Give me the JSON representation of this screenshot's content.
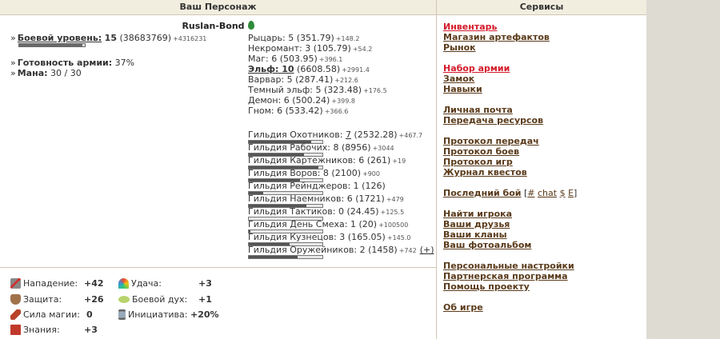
{
  "left_header": "Ваш Персонаж",
  "right_header": "Сервисы",
  "hero": {
    "name": "Ruslan-Bond",
    "combat_level_label": "Боевой уровень:",
    "combat_level_value": "15",
    "combat_level_exp": "(38683769)",
    "combat_level_delta": "+4316231",
    "combat_level_progress": 0.96,
    "army_ready_label": "Готовность армии:",
    "army_ready_value": "37%",
    "mana_label": "Мана:",
    "mana_value": "30 / 30"
  },
  "classes": [
    {
      "label": "Рыцарь: 5 (351.79)",
      "delta": "+148.2",
      "bold": false
    },
    {
      "label": "Некромант: 3 (105.79)",
      "delta": "+54.2",
      "bold": false
    },
    {
      "label": "Маг: 6 (503.95)",
      "delta": "+396.1",
      "bold": false
    },
    {
      "label_main": "Эльф: 10",
      "label_rest": " (6608.58)",
      "delta": "+2991.4",
      "bold": true
    },
    {
      "label": "Варвар: 5 (287.41)",
      "delta": "+212.6",
      "bold": false
    },
    {
      "label": "Темный эльф: 5 (323.48)",
      "delta": "+176.5",
      "bold": false
    },
    {
      "label": "Демон: 6 (500.24)",
      "delta": "+399.8",
      "bold": false
    },
    {
      "label": "Гном: 6 (533.42)",
      "delta": "+366.6",
      "bold": false
    }
  ],
  "guilds": [
    {
      "prefix": "Гильдия Охотников: ",
      "level": "7",
      "rest": " (2532.28)",
      "delta": "+467.7",
      "progress": 0.85,
      "level_link": true
    },
    {
      "prefix": "Гильдия Рабочих: 8",
      "level": "",
      "rest": " (8956)",
      "delta": "+3044",
      "progress": 0.75,
      "level_link": false
    },
    {
      "prefix": "Гильдия Картежников: 6",
      "level": "",
      "rest": " (261)",
      "delta": "+19",
      "progress": 0.95,
      "level_link": false
    },
    {
      "prefix": "Гильдия Воров: 8",
      "level": "",
      "rest": " (2100)",
      "delta": "+900",
      "progress": 0.7,
      "level_link": false
    },
    {
      "prefix": "Гильдия Рейнджеров: 1",
      "level": "",
      "rest": " (126)",
      "delta": "",
      "progress": 0.2,
      "level_link": false
    },
    {
      "prefix": "Гильдия Наемников: 6",
      "level": "",
      "rest": " (1721)",
      "delta": "+479",
      "progress": 0.78,
      "level_link": false
    },
    {
      "prefix": "Гильдия Тактиков: 0",
      "level": "",
      "rest": " (24.45)",
      "delta": "+125.5",
      "progress": 0.0,
      "level_link": false
    },
    {
      "prefix": "Гильдия День Смеха: 1",
      "level": "",
      "rest": " (20)",
      "delta": "+100500",
      "progress": 0.02,
      "level_link": false
    },
    {
      "prefix": "Гильдия Кузнецов: 3",
      "level": "",
      "rest": " (165.05)",
      "delta": "+145.0",
      "progress": 0.55,
      "level_link": false
    },
    {
      "prefix": "Гильдия Оружейников: 2",
      "level": "",
      "rest": " (1458)",
      "delta": "+742",
      "progress": 0.66,
      "level_link": false
    }
  ],
  "guild_extra_link": "(+)",
  "attributes": [
    {
      "label": "Нападение:",
      "value": "+42",
      "icon": "swords-icon"
    },
    {
      "label": "Защита:",
      "value": "+26",
      "icon": "shield-icon"
    },
    {
      "label": "Сила магии:",
      "value": "0",
      "icon": "magic-wand-icon"
    },
    {
      "label": "Знания:",
      "value": "+3",
      "icon": "book-icon"
    },
    {
      "label": "Удача:",
      "value": "+3",
      "icon": "rainbow-icon"
    },
    {
      "label": "Боевой дух:",
      "value": "+1",
      "icon": "wings-icon"
    },
    {
      "label": "Инициатива:",
      "value": "+20%",
      "icon": "hourglass-icon"
    }
  ],
  "services": {
    "inventory": "Инвентарь",
    "artifact_shop": "Магазин артефактов",
    "market": "Рынок",
    "army": "Набор армии",
    "castle": "Замок",
    "skills": "Навыки",
    "mail": "Личная почта",
    "transfer": "Передача ресурсов",
    "transfer_log": "Протокол передач",
    "battle_log": "Протокол боев",
    "game_log": "Протокол игр",
    "quest_log": "Журнал квестов",
    "last_battle": "Последний бой",
    "last_battle_open": " [",
    "last_battle_hash": "#",
    "last_battle_chat": "chat",
    "last_battle_dollar": "$",
    "last_battle_e": "E",
    "last_battle_close": "]",
    "find_player": "Найти игрока",
    "friends": "Ваши друзья",
    "clans": "Ваши кланы",
    "album": "Ваш фотоальбом",
    "settings": "Персональные настройки",
    "partner": "Партнерская программа",
    "help": "Помощь проекту",
    "about": "Об игре"
  },
  "colors": {
    "accent_red": "#d41a2a",
    "link_brown": "#5a3a1a",
    "header_bg": "#f2eedf",
    "elf_leaf": "#2e8b3a"
  }
}
